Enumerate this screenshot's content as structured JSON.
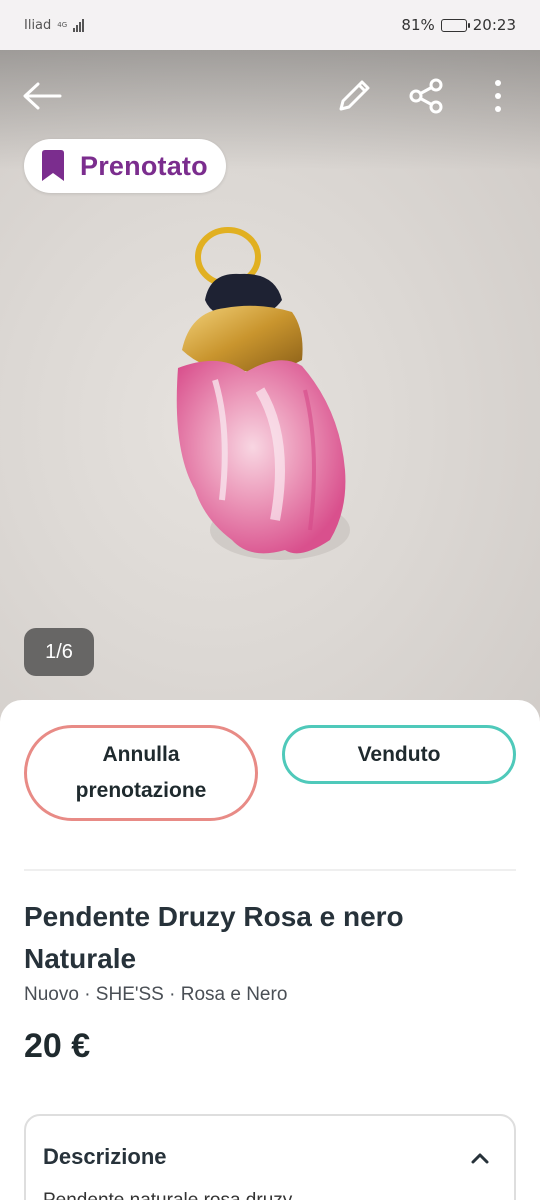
{
  "status_bar": {
    "carrier": "Iliad",
    "network": "4G",
    "battery": "81%",
    "battery_level": 0.81,
    "time": "20:23"
  },
  "toolbar": {
    "back_icon": "arrow-left-icon",
    "edit_icon": "pencil-icon",
    "share_icon": "share-icon",
    "more_icon": "more-vertical-icon"
  },
  "badge": {
    "label": "Prenotato",
    "icon": "bookmark-icon",
    "color": "#7b2d8e"
  },
  "gallery": {
    "counter": "1/6"
  },
  "actions": {
    "cancel_label": "Annulla prenotazione",
    "cancel_color": "#e88b86",
    "sold_label": "Venduto",
    "sold_color": "#4fc9ba"
  },
  "item": {
    "title": "Pendente Druzy Rosa e nero Naturale",
    "meta": "Nuovo · SHE'SS  · Rosa e Nero",
    "price": "20 €"
  },
  "description": {
    "title": "Descrizione",
    "toggle_icon": "chevron-up-icon",
    "preview": "Pendente naturale rosa druzy"
  }
}
